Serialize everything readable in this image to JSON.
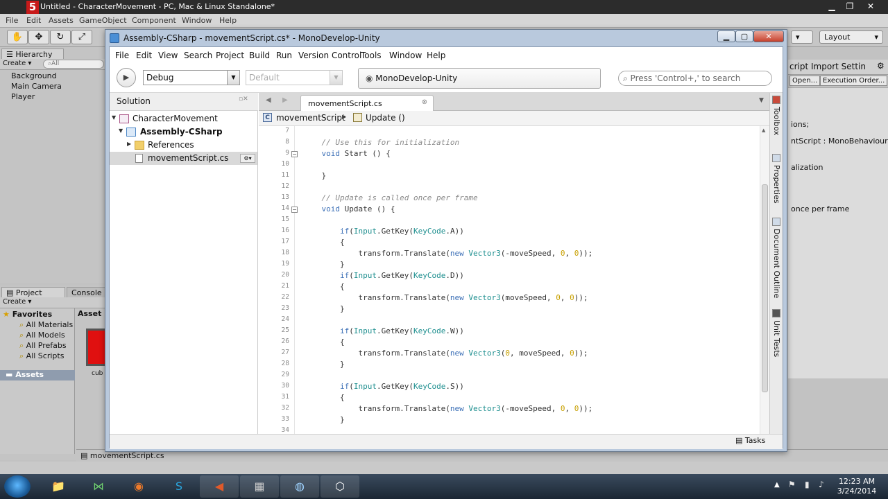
{
  "unity": {
    "title": "Untitled - CharacterMovement - PC, Mac & Linux Standalone*",
    "menu": [
      "File",
      "Edit",
      "Assets",
      "GameObject",
      "Component",
      "Window",
      "Help"
    ],
    "layout_label": "Layout",
    "hierarchy_tab": "Hierarchy",
    "create_label": "Create ▾",
    "search_all": "All",
    "hierarchy_items": [
      "Background",
      "Main Camera",
      "Player"
    ],
    "project_tab": "Project",
    "console_tab": "Console",
    "favorites_label": "Favorites",
    "favorites": [
      "All Materials",
      "All Models",
      "All Prefabs",
      "All Scripts"
    ],
    "assets_label": "Assets",
    "asset_col_header": "Asset",
    "asset_item": "cub",
    "bottom_file": "movementScript.cs",
    "inspector_header": "cript Import Settin",
    "inspector_open": "Open...",
    "inspector_exec": "Execution Order...",
    "inspector_lines": [
      "ions;",
      "ntScript : MonoBehaviour",
      "alization",
      "once per frame"
    ]
  },
  "md": {
    "title": "Assembly-CSharp - movementScript.cs* - MonoDevelop-Unity",
    "menu": [
      "File",
      "Edit",
      "View",
      "Search",
      "Project",
      "Build",
      "Run",
      "Version Control",
      "Tools",
      "Window",
      "Help"
    ],
    "config": "Debug",
    "platform": "Default",
    "status": "MonoDevelop-Unity",
    "search_placeholder": "Press 'Control+,' to search",
    "solution_label": "Solution",
    "solution_root": "CharacterMovement",
    "project": "Assembly-CSharp",
    "references": "References",
    "file": "movementScript.cs",
    "tab": "movementScript.cs",
    "path_class": "movementScript",
    "path_method": "Update ()",
    "pads": [
      "Toolbox",
      "Properties",
      "Document Outline",
      "Unit Tests"
    ],
    "tasks": "Tasks",
    "code": [
      {
        "n": "7",
        "segs": []
      },
      {
        "n": "8",
        "segs": [
          [
            "cmt",
            "    // Use this for initialization"
          ]
        ]
      },
      {
        "n": "9",
        "segs": [
          [
            "kw",
            "    void "
          ],
          [
            "",
            "Start () {"
          ]
        ]
      },
      {
        "n": "10",
        "segs": []
      },
      {
        "n": "11",
        "segs": [
          [
            "",
            "    }"
          ]
        ]
      },
      {
        "n": "12",
        "segs": []
      },
      {
        "n": "13",
        "segs": [
          [
            "cmt",
            "    // Update is called once per frame"
          ]
        ]
      },
      {
        "n": "14",
        "segs": [
          [
            "kw",
            "    void "
          ],
          [
            "",
            "Update () {"
          ]
        ]
      },
      {
        "n": "15",
        "segs": []
      },
      {
        "n": "16",
        "segs": [
          [
            "kw",
            "        if"
          ],
          [
            "",
            "("
          ],
          [
            "ty",
            "Input"
          ],
          [
            "",
            ".GetKey("
          ],
          [
            "ty",
            "KeyCode"
          ],
          [
            "",
            ".A))"
          ]
        ]
      },
      {
        "n": "17",
        "segs": [
          [
            "",
            "        {"
          ]
        ]
      },
      {
        "n": "18",
        "segs": [
          [
            "",
            "            transform.Translate("
          ],
          [
            "kw",
            "new "
          ],
          [
            "ty",
            "Vector3"
          ],
          [
            "",
            "(-moveSpeed, "
          ],
          [
            "nm",
            "0"
          ],
          [
            "",
            ", "
          ],
          [
            "nm",
            "0"
          ],
          [
            "",
            "));"
          ]
        ]
      },
      {
        "n": "19",
        "segs": [
          [
            "",
            "        }"
          ]
        ]
      },
      {
        "n": "20",
        "segs": [
          [
            "kw",
            "        if"
          ],
          [
            "",
            "("
          ],
          [
            "ty",
            "Input"
          ],
          [
            "",
            ".GetKey("
          ],
          [
            "ty",
            "KeyCode"
          ],
          [
            "",
            ".D))"
          ]
        ]
      },
      {
        "n": "21",
        "segs": [
          [
            "",
            "        {"
          ]
        ]
      },
      {
        "n": "22",
        "segs": [
          [
            "",
            "            transform.Translate("
          ],
          [
            "kw",
            "new "
          ],
          [
            "ty",
            "Vector3"
          ],
          [
            "",
            "(moveSpeed, "
          ],
          [
            "nm",
            "0"
          ],
          [
            "",
            ", "
          ],
          [
            "nm",
            "0"
          ],
          [
            "",
            "));"
          ]
        ]
      },
      {
        "n": "23",
        "segs": [
          [
            "",
            "        }"
          ]
        ]
      },
      {
        "n": "24",
        "segs": []
      },
      {
        "n": "25",
        "segs": [
          [
            "kw",
            "        if"
          ],
          [
            "",
            "("
          ],
          [
            "ty",
            "Input"
          ],
          [
            "",
            ".GetKey("
          ],
          [
            "ty",
            "KeyCode"
          ],
          [
            "",
            ".W))"
          ]
        ]
      },
      {
        "n": "26",
        "segs": [
          [
            "",
            "        {"
          ]
        ]
      },
      {
        "n": "27",
        "segs": [
          [
            "",
            "            transform.Translate("
          ],
          [
            "kw",
            "new "
          ],
          [
            "ty",
            "Vector3"
          ],
          [
            "",
            "("
          ],
          [
            "nm",
            "0"
          ],
          [
            "",
            ", moveSpeed, "
          ],
          [
            "nm",
            "0"
          ],
          [
            "",
            "));"
          ]
        ]
      },
      {
        "n": "28",
        "segs": [
          [
            "",
            "        }"
          ]
        ]
      },
      {
        "n": "29",
        "segs": []
      },
      {
        "n": "30",
        "segs": [
          [
            "kw",
            "        if"
          ],
          [
            "",
            "("
          ],
          [
            "ty",
            "Input"
          ],
          [
            "",
            ".GetKey("
          ],
          [
            "ty",
            "KeyCode"
          ],
          [
            "",
            ".S))"
          ]
        ]
      },
      {
        "n": "31",
        "segs": [
          [
            "",
            "        {"
          ]
        ]
      },
      {
        "n": "32",
        "segs": [
          [
            "",
            "            transform.Translate("
          ],
          [
            "kw",
            "new "
          ],
          [
            "ty",
            "Vector3"
          ],
          [
            "",
            "(-moveSpeed, "
          ],
          [
            "nm",
            "0"
          ],
          [
            "",
            ", "
          ],
          [
            "nm",
            "0"
          ],
          [
            "",
            "));"
          ]
        ]
      },
      {
        "n": "33",
        "segs": [
          [
            "",
            "        }"
          ]
        ]
      },
      {
        "n": "34",
        "segs": []
      }
    ]
  },
  "taskbar": {
    "time": "12:23 AM",
    "date": "3/24/2014",
    "apps": [
      "explorer-icon",
      "visual-studio-icon",
      "firefox-icon",
      "skype-icon",
      "audio-icon",
      "taskmgr-icon",
      "monodevelop-icon",
      "unity-icon"
    ]
  },
  "colors": {
    "keyword": "#3b6fb6",
    "type": "#1e8f8f",
    "number": "#c8a000",
    "comment": "#8a8a8a",
    "unity_logo": "#c81a1a"
  }
}
